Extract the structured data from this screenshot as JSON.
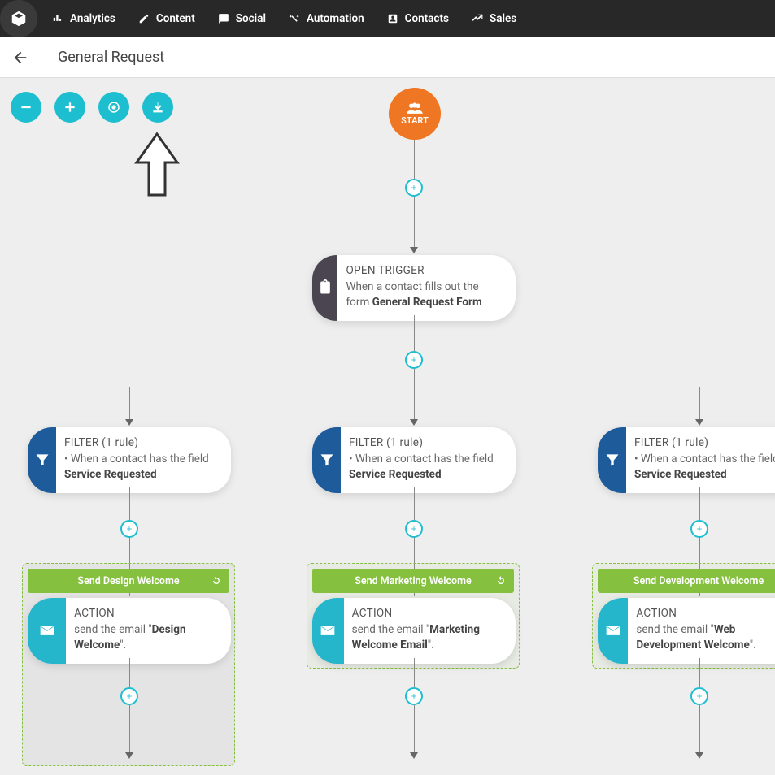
{
  "nav": {
    "items": [
      {
        "label": "Analytics"
      },
      {
        "label": "Content"
      },
      {
        "label": "Social"
      },
      {
        "label": "Automation"
      },
      {
        "label": "Contacts"
      },
      {
        "label": "Sales"
      }
    ]
  },
  "page": {
    "title": "General Request"
  },
  "start": {
    "label": "START"
  },
  "trigger": {
    "title": "OPEN TRIGGER",
    "desc_pre": "When a contact fills out the form ",
    "desc_bold": "General Request Form"
  },
  "filters": [
    {
      "title": "FILTER (1 rule)",
      "line1": "• When a contact has the field ",
      "bold": "Service Requested"
    },
    {
      "title": "FILTER (1 rule)",
      "line1": "• When a contact has the field ",
      "bold": "Service Requested"
    },
    {
      "title": "FILTER (1 rule)",
      "line1": "• When a contact has the field ",
      "bold": "Service Requested"
    }
  ],
  "groups": [
    {
      "header": "Send Design Welcome",
      "action_title": "ACTION",
      "action_pre": "send the email \"",
      "action_bold": "Design Welcome",
      "action_post": "\"."
    },
    {
      "header": "Send Marketing Welcome",
      "action_title": "ACTION",
      "action_pre": "send the email \"",
      "action_bold": "Marketing Welcome Email",
      "action_post": "\"."
    },
    {
      "header": "Send Development Welcome",
      "action_title": "ACTION",
      "action_pre": "send the email \"",
      "action_bold": "Web Development Welcome",
      "action_post": "\"."
    }
  ]
}
